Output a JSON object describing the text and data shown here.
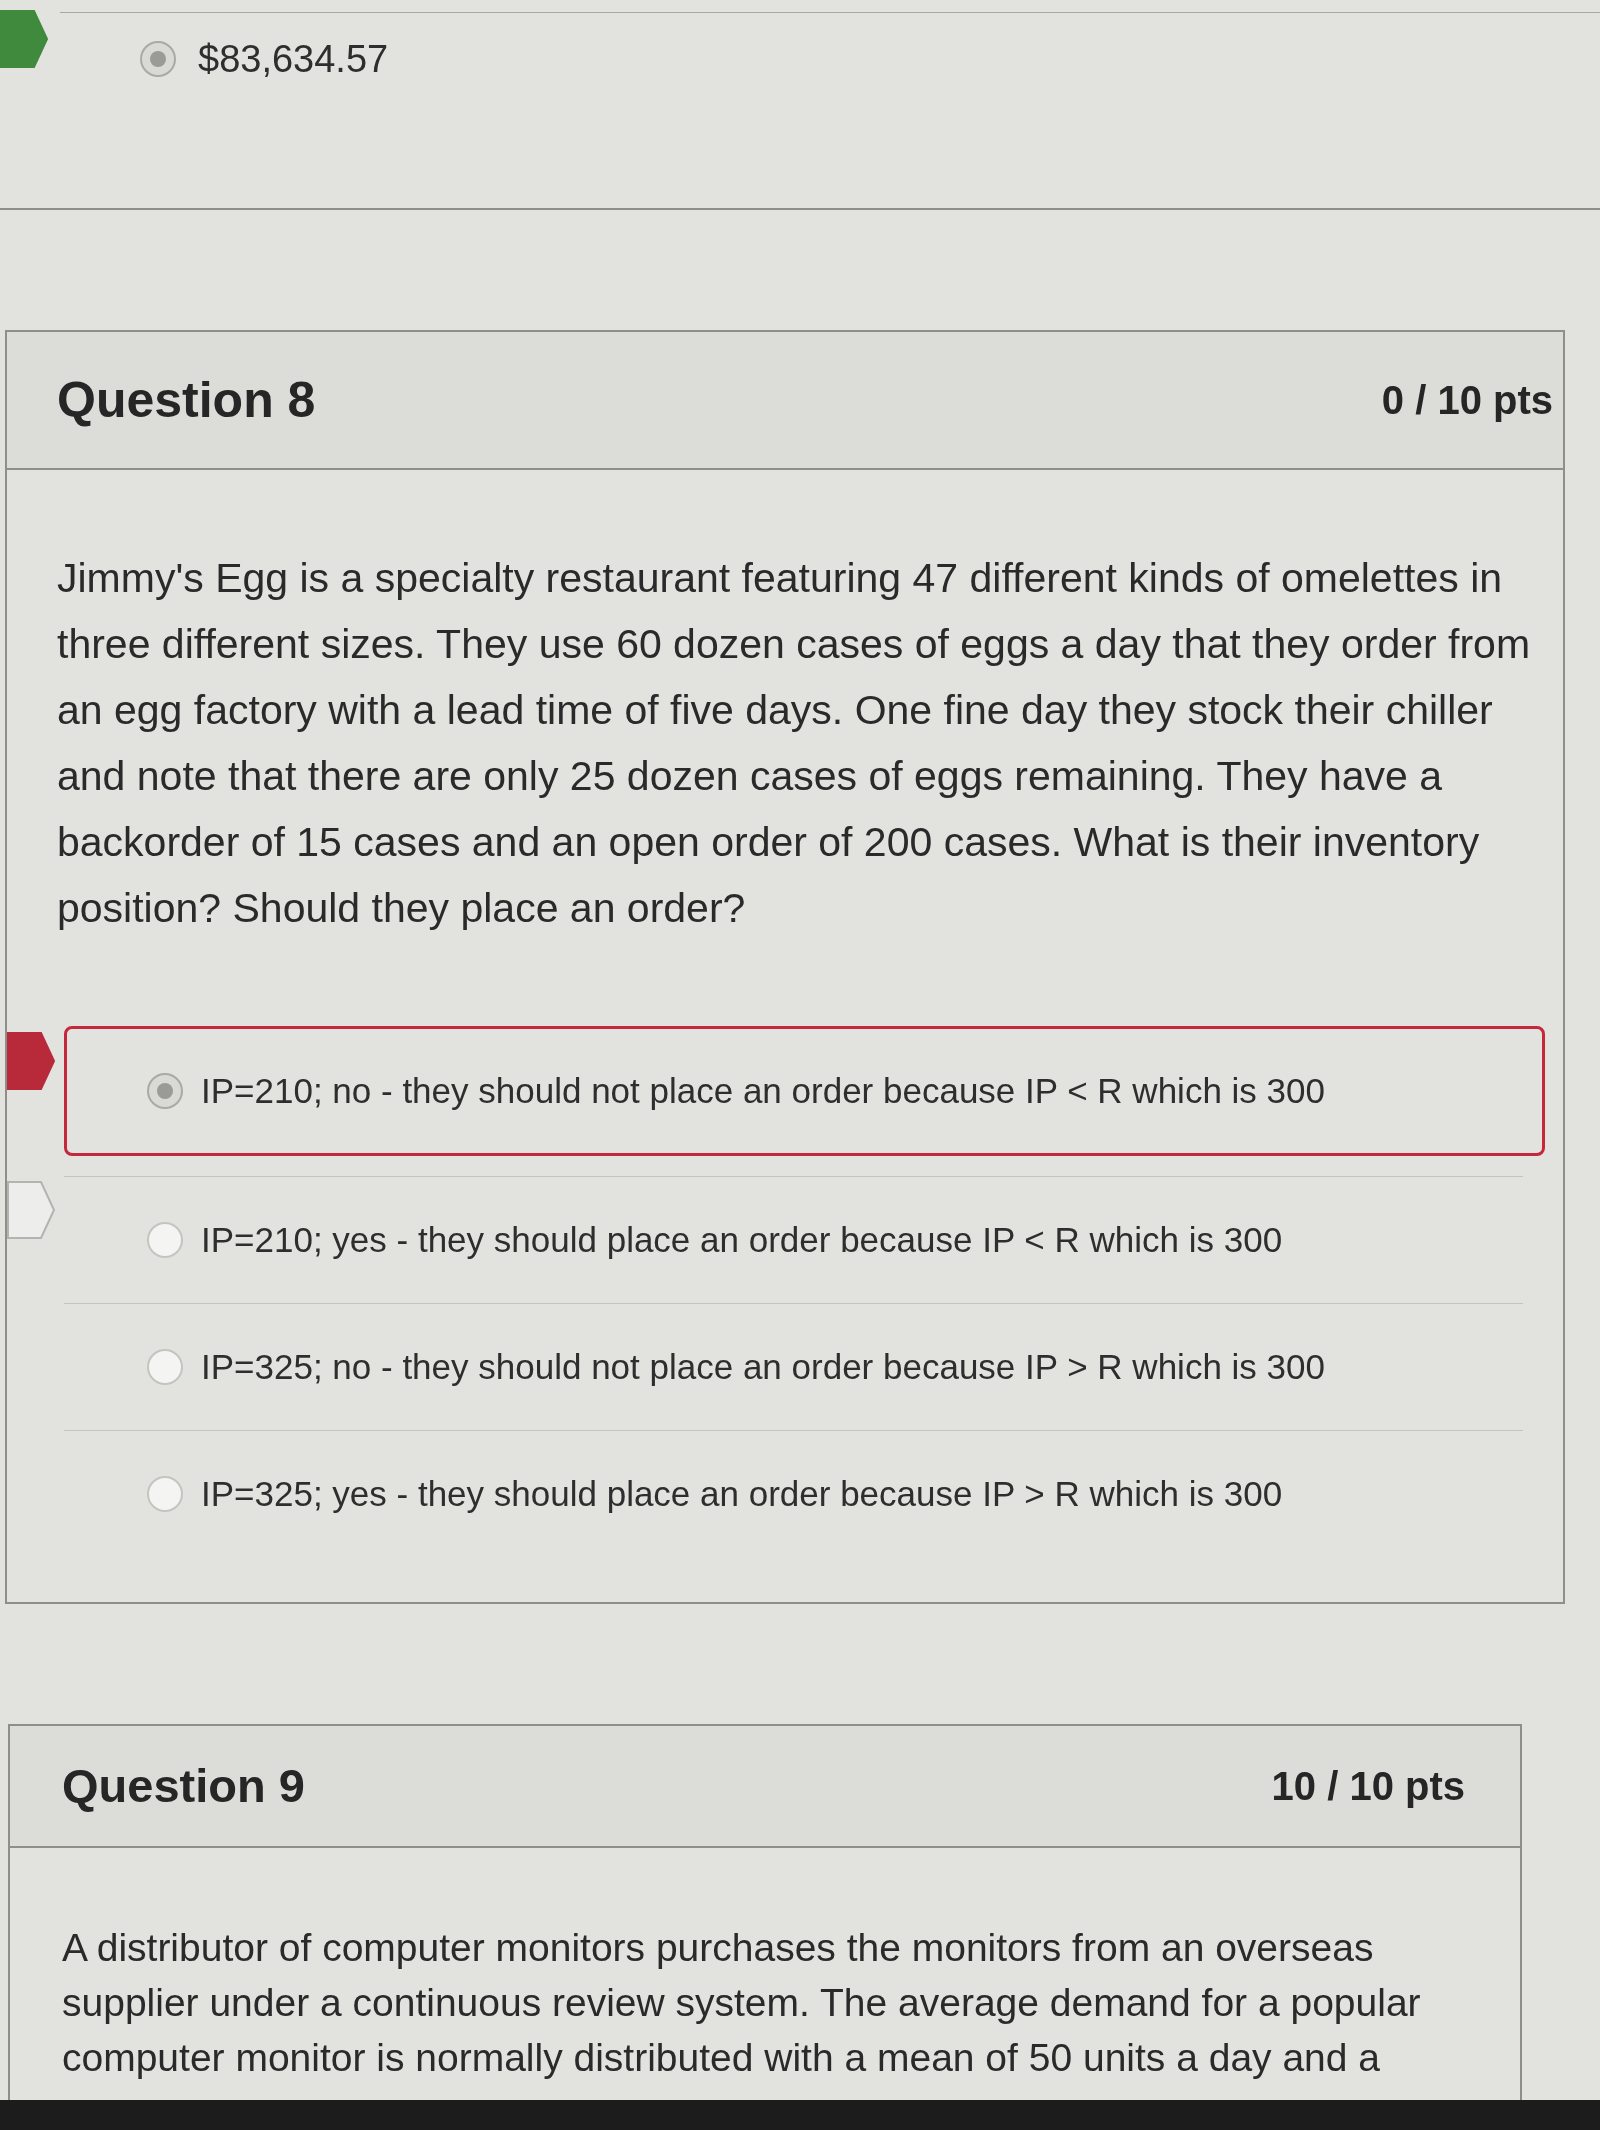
{
  "previous_question": {
    "answers": [
      {
        "text": "$83,634.57",
        "selected": true,
        "correct": true
      }
    ]
  },
  "questions": [
    {
      "title": "Question 8",
      "points": "0 / 10 pts",
      "text": "Jimmy's Egg is a specialty restaurant featuring 47 different kinds of omelettes in three different sizes. They use 60 dozen cases of eggs a day that they order from an egg factory with a lead time of five days. One fine day they stock their chiller and note that there are only 25 dozen cases of eggs remaining. They have a backorder of 15 cases and an open order of 200 cases. What is their inventory position? Should they place an order?",
      "answers": [
        {
          "text": "IP=210; no - they should not place an order because IP < R which is 300",
          "selected": true,
          "correct": false
        },
        {
          "text": "IP=210; yes - they should place an order because IP < R which is 300",
          "selected": false,
          "correct": true
        },
        {
          "text": "IP=325; no - they should not place an order because IP > R which is 300",
          "selected": false,
          "correct": false
        },
        {
          "text": "IP=325; yes - they should place an order because IP > R which is 300",
          "selected": false,
          "correct": false
        }
      ]
    },
    {
      "title": "Question 9",
      "points": "10 / 10 pts",
      "text": "A distributor of computer monitors purchases the monitors from an overseas supplier under a continuous review system. The average demand for a popular computer monitor is normally distributed with a mean of 50 units a day and a"
    }
  ]
}
